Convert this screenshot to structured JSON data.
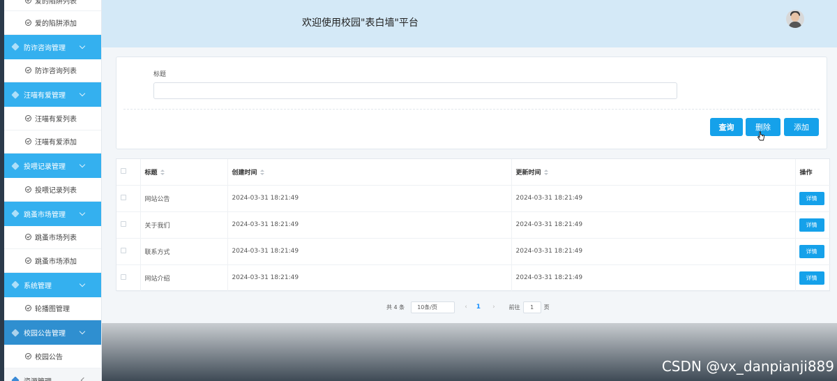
{
  "sidebar": {
    "items": [
      {
        "kind": "item",
        "label": "爱的陷阱列表"
      },
      {
        "kind": "item",
        "label": "爱的陷阱添加"
      },
      {
        "kind": "group",
        "label": "防诈咨询管理"
      },
      {
        "kind": "item",
        "label": "防诈咨询列表"
      },
      {
        "kind": "group",
        "label": "汪喵有爱管理"
      },
      {
        "kind": "item",
        "label": "汪喵有爱列表"
      },
      {
        "kind": "item",
        "label": "汪喵有爱添加"
      },
      {
        "kind": "group",
        "label": "投喂记录管理"
      },
      {
        "kind": "item",
        "label": "投喂记录列表"
      },
      {
        "kind": "group",
        "label": "跳蚤市场管理"
      },
      {
        "kind": "item",
        "label": "跳蚤市场列表"
      },
      {
        "kind": "item",
        "label": "跳蚤市场添加"
      },
      {
        "kind": "group",
        "label": "系统管理"
      },
      {
        "kind": "item",
        "label": "轮播图管理"
      },
      {
        "kind": "group",
        "label": "校园公告管理"
      },
      {
        "kind": "item",
        "label": "校园公告"
      },
      {
        "kind": "group",
        "label": "资源管理"
      }
    ]
  },
  "header": {
    "title": "欢迎使用校园\"表白墙\"平台"
  },
  "search": {
    "label": "标题",
    "value": "",
    "buttons": {
      "query": "查询",
      "delete": "删除",
      "add": "添加"
    }
  },
  "table": {
    "columns": [
      "标题",
      "创建时间",
      "更新时间",
      "操作"
    ],
    "rows": [
      {
        "title": "网站公告",
        "created": "2024-03-31 18:21:49",
        "updated": "2024-03-31 18:21:49",
        "action": "详情"
      },
      {
        "title": "关于我们",
        "created": "2024-03-31 18:21:49",
        "updated": "2024-03-31 18:21:49",
        "action": "详情"
      },
      {
        "title": "联系方式",
        "created": "2024-03-31 18:21:49",
        "updated": "2024-03-31 18:21:49",
        "action": "详情"
      },
      {
        "title": "网站介绍",
        "created": "2024-03-31 18:21:49",
        "updated": "2024-03-31 18:21:49",
        "action": "详情"
      }
    ]
  },
  "pagination": {
    "total": "共 4 条",
    "page_size": "10条/页",
    "prev": "‹",
    "current": "1",
    "next": "›",
    "goto_label": "前往",
    "goto_value": "1",
    "page_unit": "页"
  },
  "watermark": "CSDN @vx_danpianji889",
  "colors": {
    "accent": "#15a1ea",
    "sidebar_group": "#34b0ef",
    "header_bg": "#d4e9f7"
  }
}
